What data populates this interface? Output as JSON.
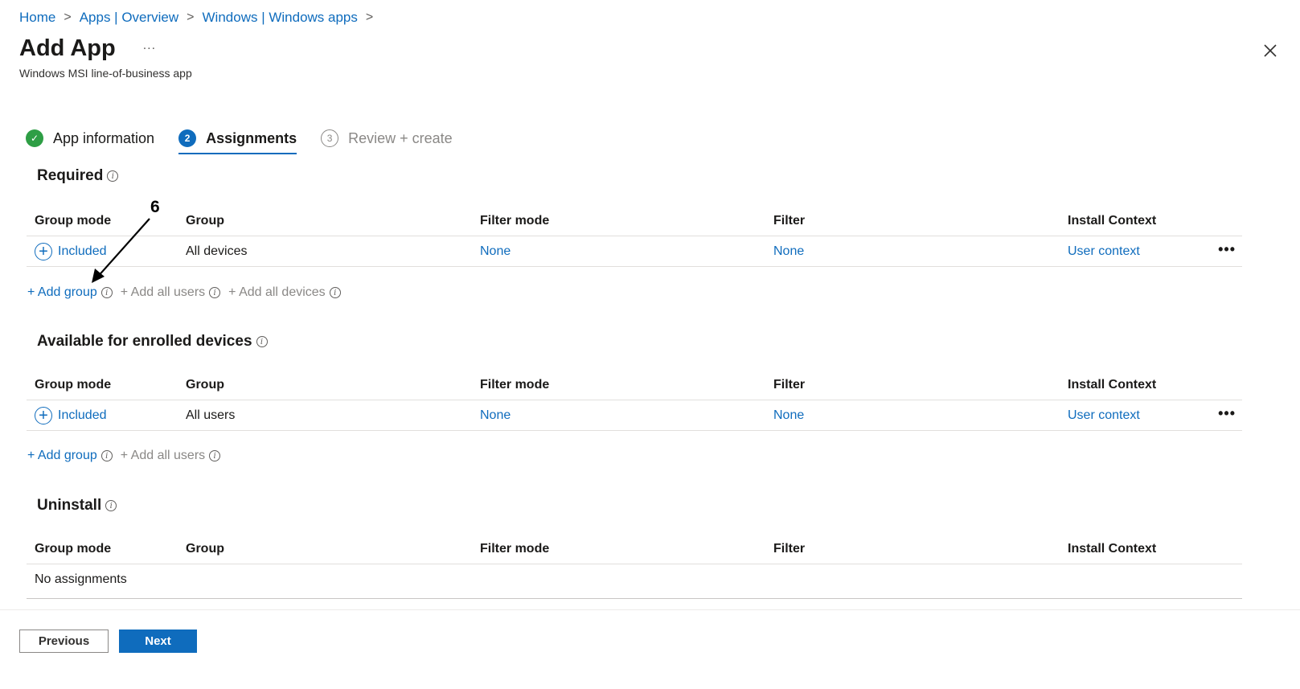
{
  "breadcrumb": {
    "items": [
      "Home",
      "Apps | Overview",
      "Windows | Windows apps"
    ],
    "separator": ">"
  },
  "header": {
    "title": "Add App",
    "more": "...",
    "subtitle": "Windows MSI line-of-business app"
  },
  "wizard": {
    "steps": [
      {
        "number": "✓",
        "label": "App information",
        "state": "done"
      },
      {
        "number": "2",
        "label": "Assignments",
        "state": "active"
      },
      {
        "number": "3",
        "label": "Review + create",
        "state": "pending"
      }
    ]
  },
  "columns": [
    "Group mode",
    "Group",
    "Filter mode",
    "Filter",
    "Install Context"
  ],
  "required": {
    "title": "Required",
    "rows": [
      {
        "mode": "Included",
        "group": "All devices",
        "filter_mode": "None",
        "filter": "None",
        "context": "User context",
        "more": "•••"
      }
    ],
    "add_group": "+ Add group",
    "add_all_users": "+ Add all users",
    "add_all_devices": "+ Add all devices"
  },
  "available": {
    "title": "Available for enrolled devices",
    "rows": [
      {
        "mode": "Included",
        "group": "All users",
        "filter_mode": "None",
        "filter": "None",
        "context": "User context",
        "more": "•••"
      }
    ],
    "add_group": "+ Add group",
    "add_all_users": "+ Add all users"
  },
  "uninstall": {
    "title": "Uninstall",
    "empty": "No assignments"
  },
  "annotation": {
    "number": "6"
  },
  "footer": {
    "previous": "Previous",
    "next": "Next"
  },
  "colors": {
    "link": "#0f6cbd",
    "success": "#2e9e45",
    "primary_button": "#0f6cbd"
  }
}
